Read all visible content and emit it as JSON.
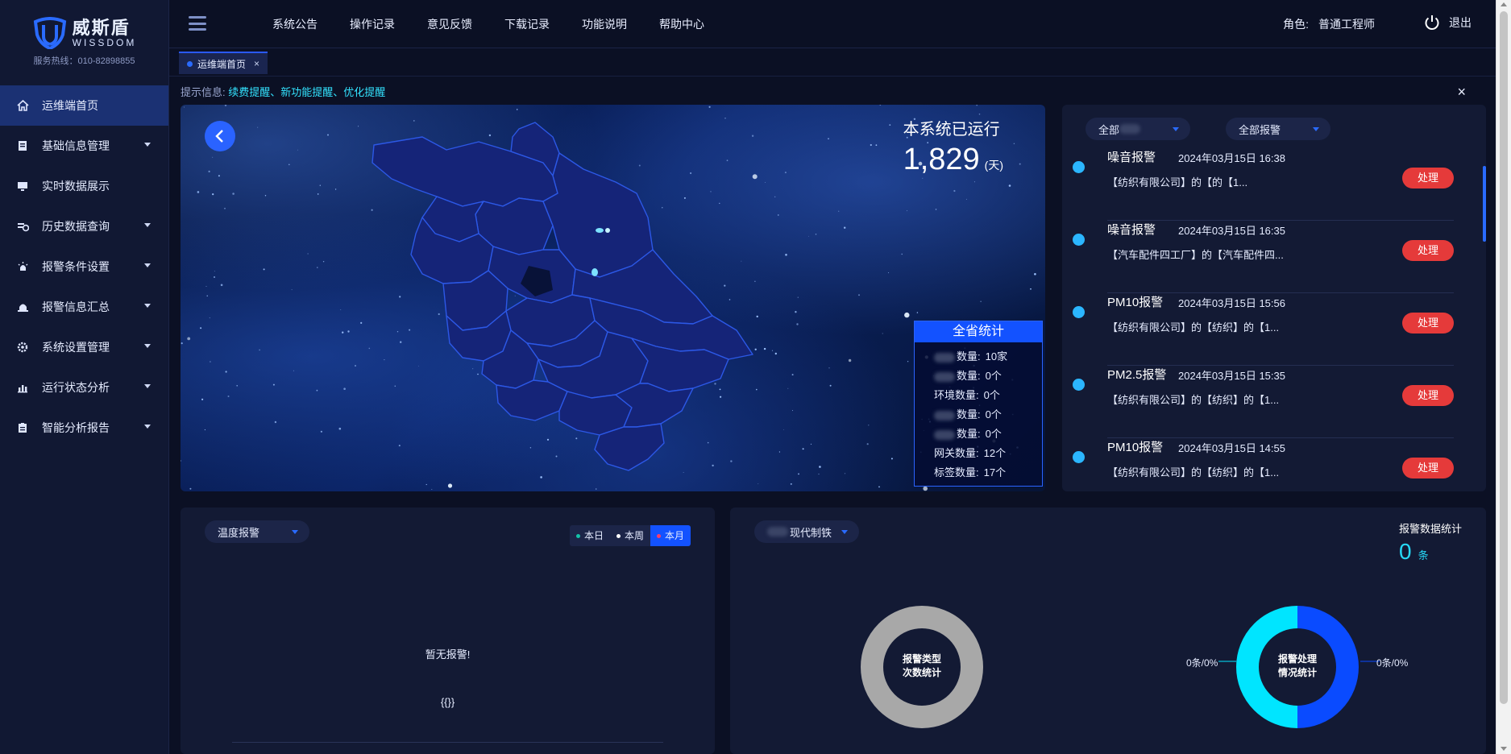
{
  "brand": {
    "name": "威斯盾",
    "english": "WISSDOM",
    "hotline": "服务热线：010-82898855"
  },
  "sidebar": {
    "items": [
      {
        "label": "运维端首页",
        "icon": "home-icon",
        "active": true,
        "expandable": false
      },
      {
        "label": "基础信息管理",
        "icon": "document-icon",
        "expandable": true
      },
      {
        "label": "实时数据展示",
        "icon": "monitor-icon",
        "expandable": false
      },
      {
        "label": "历史数据查询",
        "icon": "history-icon",
        "expandable": true
      },
      {
        "label": "报警条件设置",
        "icon": "alarm-light-icon",
        "expandable": true
      },
      {
        "label": "报警信息汇总",
        "icon": "bell-icon",
        "expandable": true
      },
      {
        "label": "系统设置管理",
        "icon": "gear-icon",
        "expandable": true
      },
      {
        "label": "运行状态分析",
        "icon": "bar-chart-icon",
        "expandable": true
      },
      {
        "label": "智能分析报告",
        "icon": "clipboard-icon",
        "expandable": true
      }
    ]
  },
  "topbar": {
    "nav": [
      "系统公告",
      "操作记录",
      "意见反馈",
      "下载记录",
      "功能说明",
      "帮助中心"
    ],
    "role_label": "角色:",
    "role_value": "普通工程师",
    "logout_label": "退出"
  },
  "tabs": [
    {
      "label": "运维端首页",
      "close": "×"
    }
  ],
  "notice": {
    "prefix": "提示信息:",
    "links": "续费提醒、新功能提醒、优化提醒",
    "close": "×"
  },
  "map_panel": {
    "runtime_label": "本系统已运行",
    "runtime_days": "1,829",
    "runtime_unit": "(天)",
    "province_stats": {
      "title": "全省统计",
      "rows": [
        {
          "label": "数量:",
          "value": "10家",
          "masked": true
        },
        {
          "label": "数量:",
          "value": "0个",
          "masked": true
        },
        {
          "label": "环境数量:",
          "value": "0个",
          "masked": false
        },
        {
          "label": "数量:",
          "value": "0个",
          "masked": true
        },
        {
          "label": "数量:",
          "value": "0个",
          "masked": true
        },
        {
          "label": "网关数量:",
          "value": "12个",
          "masked": false
        },
        {
          "label": "标签数量:",
          "value": "17个",
          "masked": false
        }
      ]
    }
  },
  "alarm_panel": {
    "filter1": "全部",
    "filter2": "全部报警",
    "action_label": "处理",
    "items": [
      {
        "type": "噪音报警",
        "time": "2024年03月15日 16:38",
        "desc": "【纺织有限公司】的【的【1..."
      },
      {
        "type": "噪音报警",
        "time": "2024年03月15日 16:35",
        "desc": "【汽车配件四工厂】的【汽车配件四..."
      },
      {
        "type": "PM10报警",
        "time": "2024年03月15日 15:56",
        "desc": "【纺织有限公司】的【纺织】的【1..."
      },
      {
        "type": "PM2.5报警",
        "time": "2024年03月15日 15:35",
        "desc": "【纺织有限公司】的【纺织】的【1..."
      },
      {
        "type": "PM10报警",
        "time": "2024年03月15日 14:55",
        "desc": "【纺织有限公司】的【纺织】的【1..."
      }
    ]
  },
  "temp_panel": {
    "select": "温度报警",
    "segments": [
      {
        "label": "本日",
        "dot": "#13c2a8",
        "on": false
      },
      {
        "label": "本周",
        "dot": "#ffffff",
        "on": false
      },
      {
        "label": "本月",
        "dot": "#ff3b6b",
        "on": true
      }
    ],
    "empty": "暂无报警!",
    "placeholder": "{{}}"
  },
  "stat_panel": {
    "select": "现代制铁",
    "title": "报警数据统计",
    "count": "0",
    "count_unit": "条",
    "donut1_label_line1": "报警类型",
    "donut1_label_line2": "次数统计",
    "donut2_label_line1": "报警处理",
    "donut2_label_line2": "情况统计",
    "donut2_left": "0条/0%",
    "donut2_right": "0条/0%",
    "donut2_fractions": [
      0.5,
      0.5
    ]
  },
  "colors": {
    "accent": "#1352ff",
    "alarm_button": "#e53a3a",
    "cyan": "#27d9f7",
    "donut_blue": "#0a4bff",
    "donut_cyan": "#00e5ff",
    "donut_gray": "#a8a8a8"
  }
}
